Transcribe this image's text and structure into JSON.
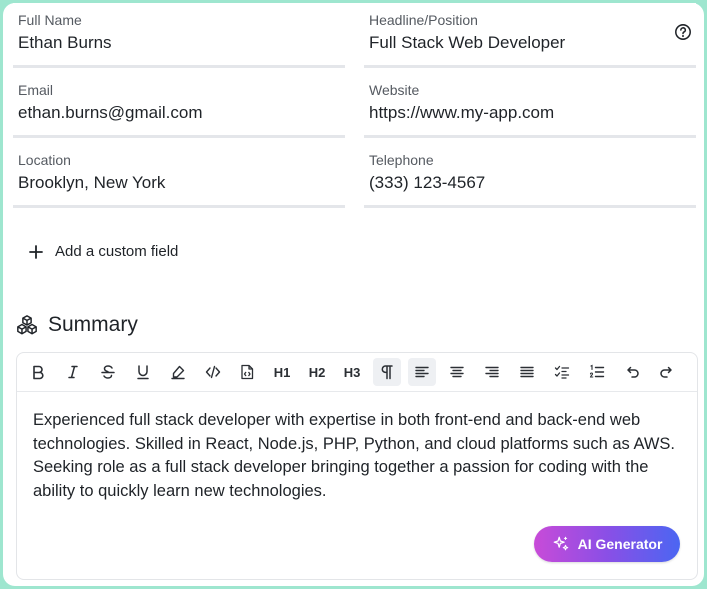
{
  "fields": {
    "full_name": {
      "label": "Full Name",
      "value": "Ethan Burns"
    },
    "headline": {
      "label": "Headline/Position",
      "value": "Full Stack Web Developer"
    },
    "email": {
      "label": "Email",
      "value": "ethan.burns@gmail.com"
    },
    "website": {
      "label": "Website",
      "value": "https://www.my-app.com"
    },
    "location": {
      "label": "Location",
      "value": "Brooklyn, New York"
    },
    "telephone": {
      "label": "Telephone",
      "value": "(333) 123-4567"
    }
  },
  "add_custom_field": {
    "icon": "plus-icon",
    "label": "Add a custom field"
  },
  "summary": {
    "icon": "cubes-icon",
    "title": "Summary",
    "text": "Experienced full stack developer with expertise in both front-end and back-end web technologies. Skilled in React, Node.js, PHP, Python, and cloud platforms such as AWS. Seeking role as a full stack developer bringing together a passion for coding with the ability to quickly learn new technologies.",
    "toolbar": {
      "h1": "H1",
      "h2": "H2",
      "h3": "H3"
    },
    "ai_button": {
      "label": "AI Generator",
      "icon": "sparkles-icon"
    }
  },
  "colors": {
    "background": "#9ee6cf",
    "ai_gradient_start": "#c84bd8",
    "ai_gradient_end": "#4b66f2"
  }
}
